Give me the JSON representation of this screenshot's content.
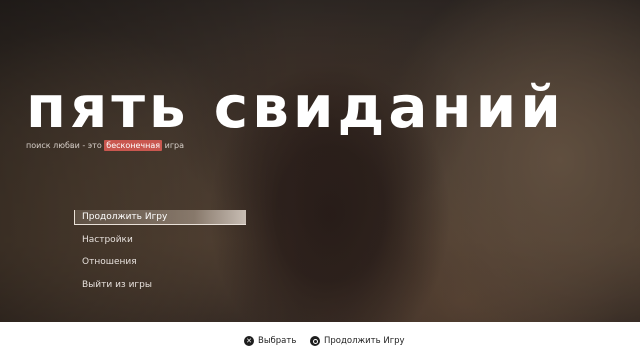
{
  "game": {
    "title": "пять свиданий",
    "tagline_before": "поиск любви - это",
    "tagline_highlight": "бесконечная",
    "tagline_after": "игра",
    "accent_color": "#c9574f"
  },
  "menu": {
    "items": [
      {
        "label": "Продолжить Игру",
        "selected": true
      },
      {
        "label": "Настройки",
        "selected": false
      },
      {
        "label": "Отношения",
        "selected": false
      },
      {
        "label": "Выйти из игры",
        "selected": false
      }
    ]
  },
  "footer": {
    "select_icon": "cross-button-icon",
    "select_label": "Выбрать",
    "continue_icon": "circle-button-icon",
    "continue_label": "Продолжить Игру"
  }
}
